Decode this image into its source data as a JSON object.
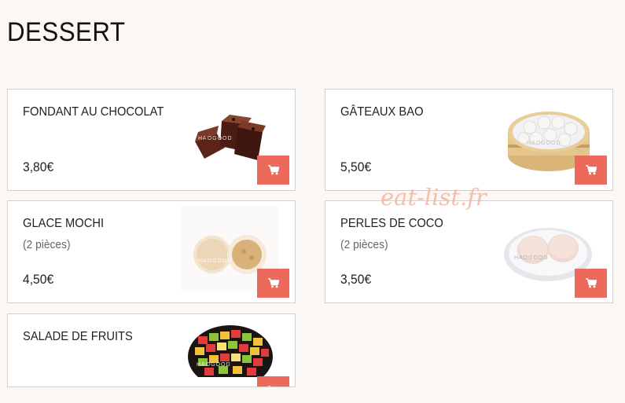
{
  "section": {
    "title": "DESSERT"
  },
  "products": [
    {
      "name": "FONDANT AU CHOCOLAT",
      "description": "",
      "price": "3,80€",
      "image": "chocolate-fondant-image",
      "image_label": "HAOGOOD"
    },
    {
      "name": "GÂTEAUX BAO",
      "description": "",
      "price": "5,50€",
      "image": "bao-buns-image",
      "image_label": "HAOGOOD"
    },
    {
      "name": "GLACE MOCHI",
      "description": "(2 pièces)",
      "price": "4,50€",
      "image": "mochi-ice-cream-image",
      "image_label": "HAOGOOD"
    },
    {
      "name": "PERLES DE COCO",
      "description": "(2 pièces)",
      "price": "3,50€",
      "image": "coconut-pearls-image",
      "image_label": "HAOGOOD"
    },
    {
      "name": "SALADE DE FRUITS",
      "description": "",
      "price": "",
      "image": "fruit-salad-image",
      "image_label": "HAOGOOD"
    }
  ],
  "cart_icon": "shopping-cart-icon",
  "watermark": "eat-list.fr",
  "colors": {
    "accent": "#ec6a5c",
    "background": "#fbf7f5",
    "card_border": "#d6d0cd"
  }
}
